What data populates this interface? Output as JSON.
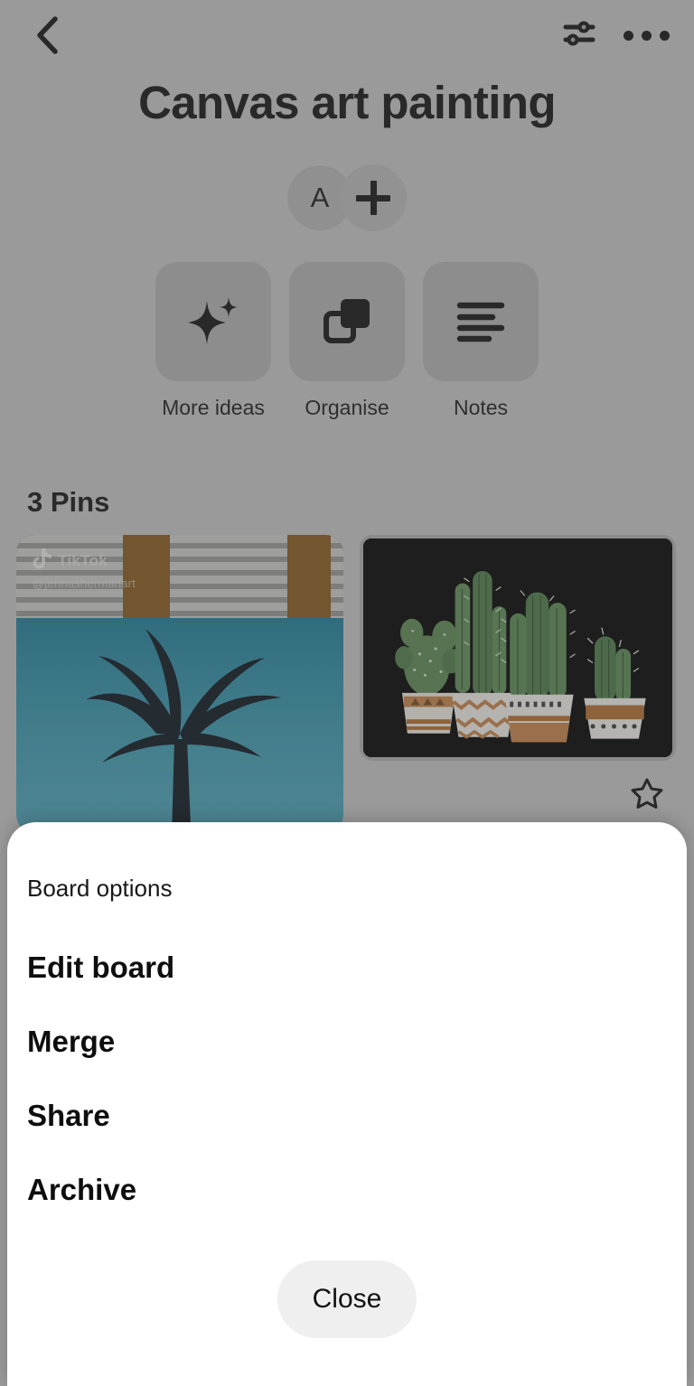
{
  "header": {
    "back_icon": "chevron-left-icon",
    "filter_icon": "sliders-icon",
    "more_icon": "three-dots-icon",
    "title": "Canvas art painting"
  },
  "collaborators": {
    "avatar_initial": "A",
    "add_label": "+",
    "add_icon": "plus-icon"
  },
  "actions": [
    {
      "label": "More ideas",
      "icon": "sparkle-icon"
    },
    {
      "label": "Organise",
      "icon": "duplicate-squares-icon"
    },
    {
      "label": "Notes",
      "icon": "text-lines-icon"
    }
  ],
  "pins": {
    "count_label": "3 Pins",
    "items": [
      {
        "name": "palm-tree-canvas-painting",
        "watermark_brand": "TikTok",
        "watermark_handle": "@jennashermanart"
      },
      {
        "name": "cactus-canvas-painting"
      }
    ],
    "favorite_icon": "star-outline-icon"
  },
  "sheet": {
    "title": "Board options",
    "items": [
      "Edit board",
      "Merge",
      "Share",
      "Archive"
    ],
    "close_label": "Close"
  },
  "colors": {
    "scrim": "#9a9a9a",
    "sheet_bg": "#ffffff",
    "close_bg": "#efefef",
    "text": "#111111",
    "canvas_black": "#000000",
    "cactus_green": "#4d7c4a",
    "pot_terracotta": "#b5702f",
    "water_blue": "#2f8fa8"
  }
}
